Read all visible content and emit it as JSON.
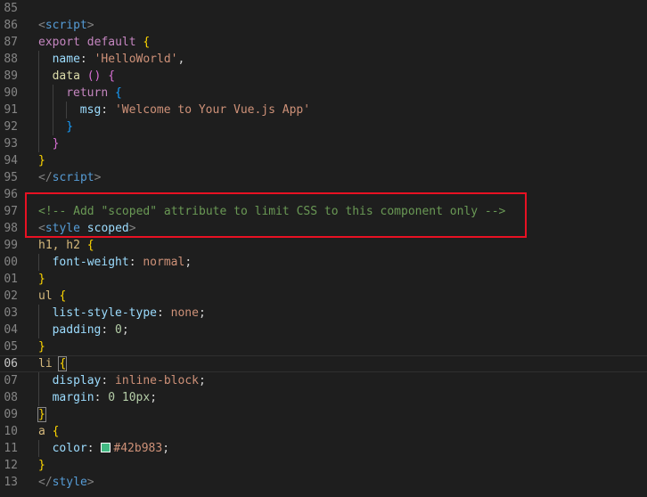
{
  "editor": {
    "colors": {
      "background": "#1e1e1e",
      "annotation_box": "#e81123",
      "swatch": "#42b983"
    },
    "lines": [
      {
        "ln": "85",
        "indent": 0,
        "segs": []
      },
      {
        "ln": "86",
        "indent": 0,
        "segs": [
          {
            "t": "<",
            "c": "tag"
          },
          {
            "t": "script",
            "c": "tagname"
          },
          {
            "t": ">",
            "c": "tag"
          }
        ]
      },
      {
        "ln": "87",
        "indent": 0,
        "segs": [
          {
            "t": "export",
            "c": "kw"
          },
          {
            "t": " ",
            "c": "punc"
          },
          {
            "t": "default",
            "c": "kw"
          },
          {
            "t": " ",
            "c": "punc"
          },
          {
            "t": "{",
            "c": "b1"
          }
        ]
      },
      {
        "ln": "88",
        "indent": 1,
        "segs": [
          {
            "t": "name",
            "c": "name"
          },
          {
            "t": ": ",
            "c": "punc"
          },
          {
            "t": "'HelloWorld'",
            "c": "str"
          },
          {
            "t": ",",
            "c": "punc"
          }
        ]
      },
      {
        "ln": "89",
        "indent": 1,
        "segs": [
          {
            "t": "data",
            "c": "fn"
          },
          {
            "t": " ",
            "c": "punc"
          },
          {
            "t": "()",
            "c": "b2"
          },
          {
            "t": " ",
            "c": "punc"
          },
          {
            "t": "{",
            "c": "b2"
          }
        ]
      },
      {
        "ln": "90",
        "indent": 2,
        "segs": [
          {
            "t": "return",
            "c": "kw"
          },
          {
            "t": " ",
            "c": "punc"
          },
          {
            "t": "{",
            "c": "b3"
          }
        ]
      },
      {
        "ln": "91",
        "indent": 3,
        "segs": [
          {
            "t": "msg",
            "c": "name"
          },
          {
            "t": ": ",
            "c": "punc"
          },
          {
            "t": "'Welcome to Your Vue.js App'",
            "c": "str"
          }
        ]
      },
      {
        "ln": "92",
        "indent": 2,
        "segs": [
          {
            "t": "}",
            "c": "b3"
          }
        ]
      },
      {
        "ln": "93",
        "indent": 1,
        "segs": [
          {
            "t": "}",
            "c": "b2"
          }
        ]
      },
      {
        "ln": "94",
        "indent": 0,
        "segs": [
          {
            "t": "}",
            "c": "b1"
          }
        ]
      },
      {
        "ln": "95",
        "indent": 0,
        "segs": [
          {
            "t": "</",
            "c": "tag"
          },
          {
            "t": "script",
            "c": "tagname"
          },
          {
            "t": ">",
            "c": "tag"
          }
        ]
      },
      {
        "ln": "96",
        "indent": 0,
        "segs": []
      },
      {
        "ln": "97",
        "indent": 0,
        "segs": [
          {
            "t": "<!-- Add \"scoped\" attribute to limit CSS to this component only -->",
            "c": "com"
          }
        ]
      },
      {
        "ln": "98",
        "indent": 0,
        "segs": [
          {
            "t": "<",
            "c": "tag"
          },
          {
            "t": "style",
            "c": "tagname"
          },
          {
            "t": " ",
            "c": "punc"
          },
          {
            "t": "scoped",
            "c": "attr"
          },
          {
            "t": ">",
            "c": "tag"
          }
        ]
      },
      {
        "ln": "99",
        "indent": 0,
        "segs": [
          {
            "t": "h1, h2",
            "c": "sel"
          },
          {
            "t": " ",
            "c": "punc"
          },
          {
            "t": "{",
            "c": "b1"
          }
        ]
      },
      {
        "ln": "00",
        "indent": 1,
        "segs": [
          {
            "t": "font-weight",
            "c": "prop"
          },
          {
            "t": ": ",
            "c": "punc"
          },
          {
            "t": "normal",
            "c": "val"
          },
          {
            "t": ";",
            "c": "punc"
          }
        ]
      },
      {
        "ln": "01",
        "indent": 0,
        "segs": [
          {
            "t": "}",
            "c": "b1"
          }
        ]
      },
      {
        "ln": "02",
        "indent": 0,
        "segs": [
          {
            "t": "ul",
            "c": "sel"
          },
          {
            "t": " ",
            "c": "punc"
          },
          {
            "t": "{",
            "c": "b1"
          }
        ]
      },
      {
        "ln": "03",
        "indent": 1,
        "segs": [
          {
            "t": "list-style-type",
            "c": "prop"
          },
          {
            "t": ": ",
            "c": "punc"
          },
          {
            "t": "none",
            "c": "val"
          },
          {
            "t": ";",
            "c": "punc"
          }
        ]
      },
      {
        "ln": "04",
        "indent": 1,
        "segs": [
          {
            "t": "padding",
            "c": "prop"
          },
          {
            "t": ": ",
            "c": "punc"
          },
          {
            "t": "0",
            "c": "num"
          },
          {
            "t": ";",
            "c": "punc"
          }
        ]
      },
      {
        "ln": "05",
        "indent": 0,
        "segs": [
          {
            "t": "}",
            "c": "b1"
          }
        ]
      },
      {
        "ln": "06",
        "indent": 0,
        "current": true,
        "segs": [
          {
            "t": "li",
            "c": "sel"
          },
          {
            "t": " ",
            "c": "punc"
          },
          {
            "t": "{",
            "c": "b1",
            "match": true
          }
        ]
      },
      {
        "ln": "07",
        "indent": 1,
        "segs": [
          {
            "t": "display",
            "c": "prop"
          },
          {
            "t": ": ",
            "c": "punc"
          },
          {
            "t": "inline-block",
            "c": "val"
          },
          {
            "t": ";",
            "c": "punc"
          }
        ]
      },
      {
        "ln": "08",
        "indent": 1,
        "segs": [
          {
            "t": "margin",
            "c": "prop"
          },
          {
            "t": ": ",
            "c": "punc"
          },
          {
            "t": "0",
            "c": "num"
          },
          {
            "t": " ",
            "c": "punc"
          },
          {
            "t": "10px",
            "c": "num"
          },
          {
            "t": ";",
            "c": "punc"
          }
        ]
      },
      {
        "ln": "09",
        "indent": 0,
        "segs": [
          {
            "t": "}",
            "c": "b1",
            "match": true
          }
        ]
      },
      {
        "ln": "10",
        "indent": 0,
        "segs": [
          {
            "t": "a",
            "c": "sel"
          },
          {
            "t": " ",
            "c": "punc"
          },
          {
            "t": "{",
            "c": "b1"
          }
        ]
      },
      {
        "ln": "11",
        "indent": 1,
        "segs": [
          {
            "t": "color",
            "c": "prop"
          },
          {
            "t": ": ",
            "c": "punc"
          },
          {
            "t": "",
            "c": "swatch"
          },
          {
            "t": "#42b983",
            "c": "val"
          },
          {
            "t": ";",
            "c": "punc"
          }
        ]
      },
      {
        "ln": "12",
        "indent": 0,
        "segs": [
          {
            "t": "}",
            "c": "b1"
          }
        ]
      },
      {
        "ln": "13",
        "indent": 0,
        "segs": [
          {
            "t": "</",
            "c": "tag"
          },
          {
            "t": "style",
            "c": "tagname"
          },
          {
            "t": ">",
            "c": "tag"
          }
        ]
      }
    ]
  }
}
